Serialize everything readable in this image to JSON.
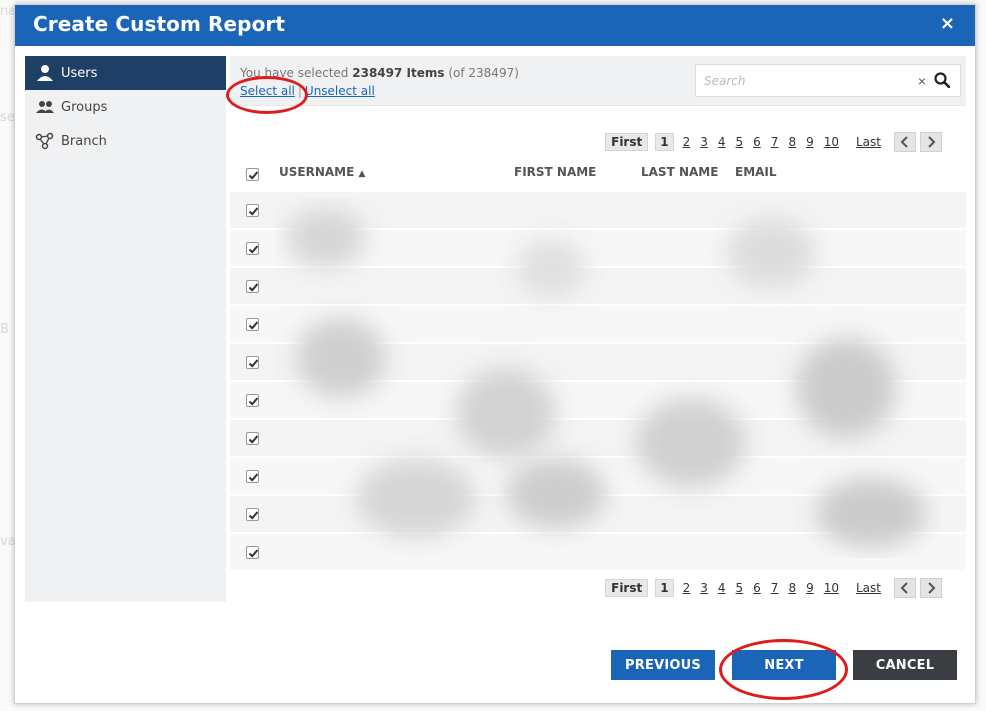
{
  "dialog": {
    "title": "Create Custom Report",
    "close_label": "×"
  },
  "sidebar": {
    "items": [
      {
        "label": "Users",
        "icon": "user-icon",
        "active": true
      },
      {
        "label": "Groups",
        "icon": "users-group-icon",
        "active": false
      },
      {
        "label": "Branch",
        "icon": "branch-icon",
        "active": false
      }
    ]
  },
  "selection": {
    "prefix": "You have selected",
    "count": "238497 Items",
    "total": "(of 238497)",
    "select_all": "Select all",
    "separator": "|",
    "unselect_all": "Unselect all"
  },
  "search": {
    "placeholder": "Search",
    "clear_label": "×"
  },
  "pagination": {
    "first": "First",
    "current": "1",
    "pages": [
      "2",
      "3",
      "4",
      "5",
      "6",
      "7",
      "8",
      "9",
      "10"
    ],
    "last": "Last"
  },
  "table": {
    "columns": [
      "USERNAME",
      "FIRST NAME",
      "LAST NAME",
      "EMAIL"
    ],
    "sort_indicator": "▲",
    "row_count": 10
  },
  "footer": {
    "previous": "PREVIOUS",
    "next": "NEXT",
    "cancel": "CANCEL"
  },
  "colors": {
    "header": "#1a65b8",
    "sidebar_active": "#1e3f66",
    "cancel": "#3a3d42",
    "annotation": "#e01b1b"
  }
}
